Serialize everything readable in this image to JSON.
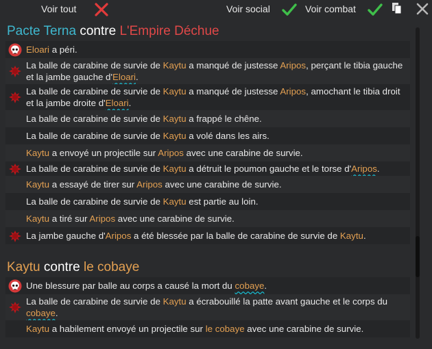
{
  "toolbar": {
    "show_all_label": "Voir tout",
    "show_social_label": "Voir social",
    "show_combat_label": "Voir combat"
  },
  "colors": {
    "faction_blue": "#3fb8cf",
    "faction_red": "#e04848",
    "name_orange": "#e3a052",
    "check_green": "#3fbf4a",
    "cross_red": "#e23b3b",
    "underline_cyan": "#19b5c8"
  },
  "icons": [
    "close-x-icon",
    "checkmark-icon",
    "copy-icon",
    "skull-icon",
    "blood-splatter-icon"
  ],
  "section1": {
    "title_a": "Pacte Terna",
    "title_vs": " contre ",
    "title_b": "L'Empire Déchue",
    "rows": [
      {
        "p": [
          "",
          "Eloari",
          " a péri."
        ]
      },
      {
        "p": [
          "La balle de carabine de survie de ",
          "Kaytu",
          " a manqué de justesse ",
          "Aripos",
          ", perçant le tibia gauche et la jambe gauche d'",
          "Eloari",
          "."
        ]
      },
      {
        "p": [
          "La balle de carabine de survie de ",
          "Kaytu",
          " a manqué de justesse ",
          "Aripos",
          ", amochant le tibia droit et la jambe droite d'",
          "Eloari",
          "."
        ]
      },
      {
        "p": [
          "La balle de carabine de survie de ",
          "Kaytu",
          " a frappé le chêne."
        ]
      },
      {
        "p": [
          "La balle de carabine de survie de ",
          "Kaytu",
          " a volé dans les airs."
        ]
      },
      {
        "p": [
          "",
          "Kaytu",
          " a envoyé un projectile sur ",
          "Aripos",
          " avec une carabine de survie."
        ]
      },
      {
        "p": [
          "La balle de carabine de survie de ",
          "Kaytu",
          " a détruit le poumon gauche et le torse d'",
          "Aripos",
          "."
        ]
      },
      {
        "p": [
          "",
          "Kaytu",
          " a essayé de tirer sur ",
          "Aripos",
          " avec une carabine de survie."
        ]
      },
      {
        "p": [
          "La balle de carabine de survie de ",
          "Kaytu",
          " est partie au loin."
        ]
      },
      {
        "p": [
          "",
          "Kaytu",
          " a tiré sur ",
          "Aripos",
          " avec une carabine de survie."
        ]
      },
      {
        "p": [
          "La jambe gauche d'",
          "Aripos",
          " a été blessée par la balle de carabine de survie de ",
          "Kaytu",
          "."
        ]
      }
    ]
  },
  "section2": {
    "title_a": "Kaytu",
    "title_vs": " contre ",
    "title_b": "le cobaye",
    "rows": [
      {
        "p": [
          "Une blessure par balle au corps a causé la mort du ",
          "cobaye",
          "."
        ]
      },
      {
        "p": [
          "La balle de carabine de survie de ",
          "Kaytu",
          " a écrabouillé la patte avant gauche et le corps du ",
          "cobaye",
          "."
        ]
      },
      {
        "p": [
          "",
          "Kaytu",
          " a habilement envoyé un projectile sur ",
          "le cobaye",
          " avec une carabine de survie."
        ]
      }
    ]
  }
}
